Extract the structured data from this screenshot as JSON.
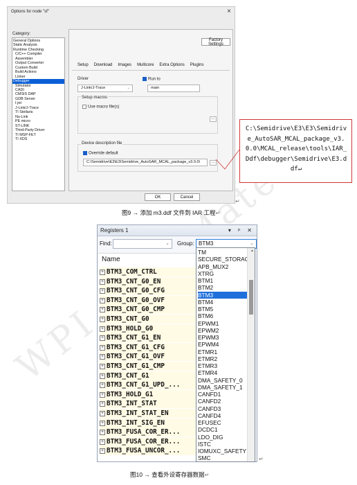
{
  "watermark": "WPI ATU Material",
  "dialog": {
    "title": "Options for node \"sf\"",
    "close": "×",
    "category_label": "Category:",
    "categories": [
      {
        "label": "General Options",
        "sub": false
      },
      {
        "label": "Static Analysis",
        "sub": false
      },
      {
        "label": "Runtime Checking",
        "sub": false
      },
      {
        "label": "C/C++ Compiler",
        "sub": true
      },
      {
        "label": "Assembler",
        "sub": true
      },
      {
        "label": "Output Converter",
        "sub": true
      },
      {
        "label": "Custom Build",
        "sub": true
      },
      {
        "label": "Build Actions",
        "sub": true
      },
      {
        "label": "Linker",
        "sub": true
      },
      {
        "label": "Debugger",
        "sub": false,
        "selected": true
      },
      {
        "label": "Simulator",
        "sub": true
      },
      {
        "label": "CADI",
        "sub": true
      },
      {
        "label": "CMSIS DAP",
        "sub": true
      },
      {
        "label": "GDB Server",
        "sub": true
      },
      {
        "label": "I-jet",
        "sub": true
      },
      {
        "label": "J-Link/J-Trace",
        "sub": true
      },
      {
        "label": "TI Stellaris",
        "sub": true
      },
      {
        "label": "Nu-Link",
        "sub": true
      },
      {
        "label": "PE micro",
        "sub": true
      },
      {
        "label": "ST-LINK",
        "sub": true
      },
      {
        "label": "Third-Party Driver",
        "sub": true
      },
      {
        "label": "TI MSP-FET",
        "sub": true
      },
      {
        "label": "TI XDS",
        "sub": true
      }
    ],
    "factory_settings": "Factory Settings",
    "tabs": [
      "Setup",
      "Download",
      "Images",
      "Multicore",
      "Extra Options",
      "Plugins"
    ],
    "driver_label": "Driver",
    "driver_value": "J-Link/J-Trace",
    "run_to_label": "Run to",
    "run_to_checked": true,
    "run_to_value": "main",
    "setup_macros_label": "Setup macros",
    "use_macro_label": "Use macro file(s)",
    "use_macro_checked": false,
    "ddf_label": "Device description file",
    "override_label": "Override default",
    "override_checked": true,
    "ddf_path": "C:\\Semidrive\\E3\\E3\\Semidrive_AutoSAR_MCAL_package_v3.0.0\\",
    "browse": "...",
    "ok": "OK",
    "cancel": "Cancel"
  },
  "callout_text": "C:\\Semidrive\\E3\\E3\\Semidrive_AutoSAR_MCAL_package_v3.0.0\\MCAL_release\\tools\\IAR_Ddf\\debugger\\Semidrive\\E3.ddf↵",
  "caption9": "图9 → 添加 m3.ddf 文件到 IAR 工程",
  "caption10": "图10 → 查看外设寄存器数据",
  "return_mark": "↵",
  "registers": {
    "title": "Registers 1",
    "title_icons": "▾ ᵖ ✕",
    "find_label": "Find:",
    "group_label": "Group:",
    "group_value": "BTM3",
    "column_name": "Name",
    "rows": [
      "BTM3_COM_CTRL",
      "BTM3_CNT_G0_EN",
      "BTM3_CNT_G0_CFG",
      "BTM3_CNT_G0_OVF",
      "BTM3_CNT_G0_CMP",
      "BTM3_CNT_G0",
      "BTM3_HOLD_G0",
      "BTM3_CNT_G1_EN",
      "BTM3_CNT_G1_CFG",
      "BTM3_CNT_G1_OVF",
      "BTM3_CNT_G1_CMP",
      "BTM3_CNT_G1",
      "BTM3_CNT_G1_UPD_...",
      "BTM3_HOLD_G1",
      "BTM3_INT_STAT",
      "BTM3_INT_STAT_EN",
      "BTM3_INT_SIG_EN",
      "BTM3_FUSA_COR_ER...",
      "BTM3_FUSA_COR_ER...",
      "BTM3_FUSA_UNCOR_..."
    ],
    "groups": [
      "TM",
      "SECURE_STORAGE",
      "APB_MUX2",
      "XTRG",
      "BTM1",
      "BTM2",
      "BTM3",
      "BTM4",
      "BTM5",
      "BTM6",
      "EPWM1",
      "EPWM2",
      "EPWM3",
      "EPWM4",
      "ETMR1",
      "ETMR2",
      "ETMR3",
      "ETMR4",
      "DMA_SAFETY_0",
      "DMA_SAFETY_1",
      "CANFD1",
      "CANFD2",
      "CANFD3",
      "CANFD4",
      "EFUSEC",
      "DCDC1",
      "LDO_DIG",
      "ISTC",
      "IOMUXC_SAFETY",
      "SMC"
    ],
    "selected_group": "BTM3"
  }
}
